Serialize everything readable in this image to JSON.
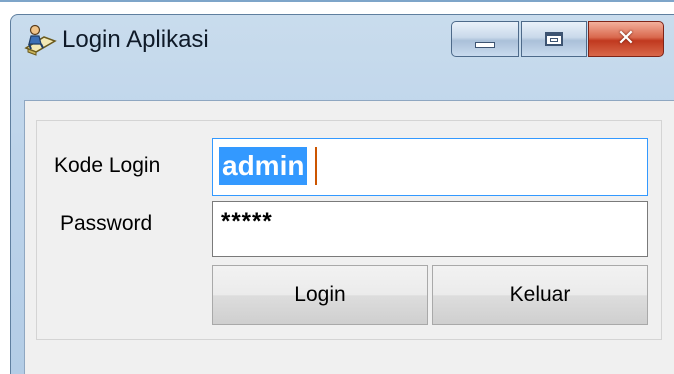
{
  "window": {
    "title": "Login Aplikasi",
    "icon": "login-app-icon"
  },
  "titlebar_buttons": {
    "minimize_icon": "minimize-icon",
    "maximize_icon": "maximize-icon",
    "close_icon": "close-icon",
    "close_glyph": "✕"
  },
  "form": {
    "kode_login_label": "Kode Login",
    "kode_login_value": "admin",
    "password_label": "Password",
    "password_value": "*****"
  },
  "buttons": {
    "login_label": "Login",
    "keluar_label": "Keluar"
  },
  "colors": {
    "selection": "#3399ff",
    "close_button": "#c0391f",
    "titlebar": "#bcd3ea",
    "client_background": "#f0f0f0"
  }
}
